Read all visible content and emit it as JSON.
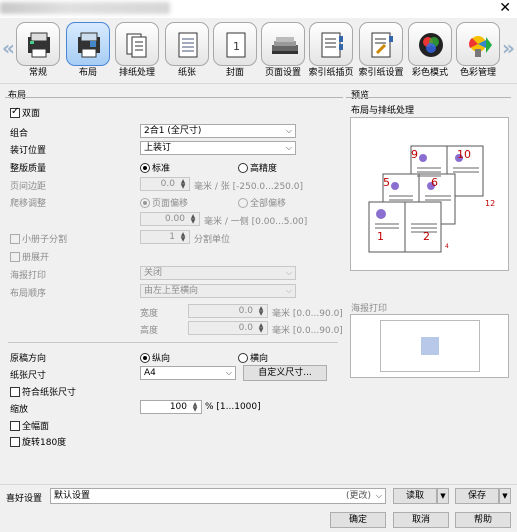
{
  "window": {
    "close_glyph": "✕"
  },
  "toolbar": {
    "left_arrow": "«",
    "right_arrow": "»",
    "tabs": [
      {
        "label": "常规",
        "icon": "printer-icon"
      },
      {
        "label": "布局",
        "icon": "layout-icon",
        "selected": true
      },
      {
        "label": "排纸处理",
        "icon": "finishing-icon"
      },
      {
        "label": "纸张",
        "icon": "paper-icon"
      },
      {
        "label": "封面",
        "icon": "cover-icon"
      },
      {
        "label": "页面设置",
        "icon": "page-setup-icon"
      },
      {
        "label": "索引纸插页",
        "icon": "tab-insert-icon"
      },
      {
        "label": "索引纸设置",
        "icon": "tab-settings-icon"
      },
      {
        "label": "彩色模式",
        "icon": "color-mode-icon"
      },
      {
        "label": "色彩管理",
        "icon": "color-management-icon"
      }
    ]
  },
  "layout": {
    "section_title": "布局",
    "duplex_label": "双面",
    "duplex_checked": true,
    "combine_label": "组合",
    "combine_value": "2合1 (全尺寸)",
    "binding_label": "装订位置",
    "binding_value": "上装订",
    "quality_label": "整版质量",
    "quality_standard": "标准",
    "quality_high": "高精度",
    "page_margin_label": "页间边距",
    "page_margin_value": "0.0",
    "page_margin_unit": "毫米 / 张 [-250.0...250.0]",
    "shift_label": "爬移调整",
    "shift_page": "页面偏移",
    "shift_all": "全部偏移",
    "shift_value": "0.00",
    "shift_unit": "毫米 / 一侧 [0.00...5.00]",
    "booklet_split_label": "小册子分割",
    "booklet_split_value": "1",
    "booklet_split_unit": "分割单位",
    "spread_label": "册展开",
    "poster_label": "海报打印",
    "poster_value": "关闭",
    "order_label": "布局顺序",
    "order_value": "由左上至横向",
    "width_label": "宽度",
    "width_value": "0.0",
    "width_unit": "毫米 [0.0...90.0]",
    "height_label": "高度",
    "height_value": "0.0",
    "height_unit": "毫米 [0.0...90.0]"
  },
  "orientation": {
    "label": "原稿方向",
    "portrait": "纵向",
    "landscape": "横向"
  },
  "paper": {
    "size_label": "纸张尺寸",
    "size_value": "A4",
    "custom_button": "自定义尺寸...",
    "fit_label": "符合纸张尺寸",
    "zoom_label": "缩放",
    "zoom_value": "100",
    "zoom_unit": "% [1...1000]",
    "fullbleed_label": "全幅面",
    "rotate_label": "旋转180度"
  },
  "preview": {
    "title": "预览",
    "subtitle": "布局与排纸处理",
    "poster_title": "海报打印",
    "page_numbers": [
      "9",
      "10",
      "5",
      "6",
      "1",
      "2",
      "12",
      "4"
    ]
  },
  "footer": {
    "favorites_label": "喜好设置",
    "favorites_value": "默认设置",
    "changed_note": "(更改)",
    "load_button": "读取",
    "save_button": "保存",
    "ok_button": "确定",
    "cancel_button": "取消",
    "help_button": "帮助"
  }
}
